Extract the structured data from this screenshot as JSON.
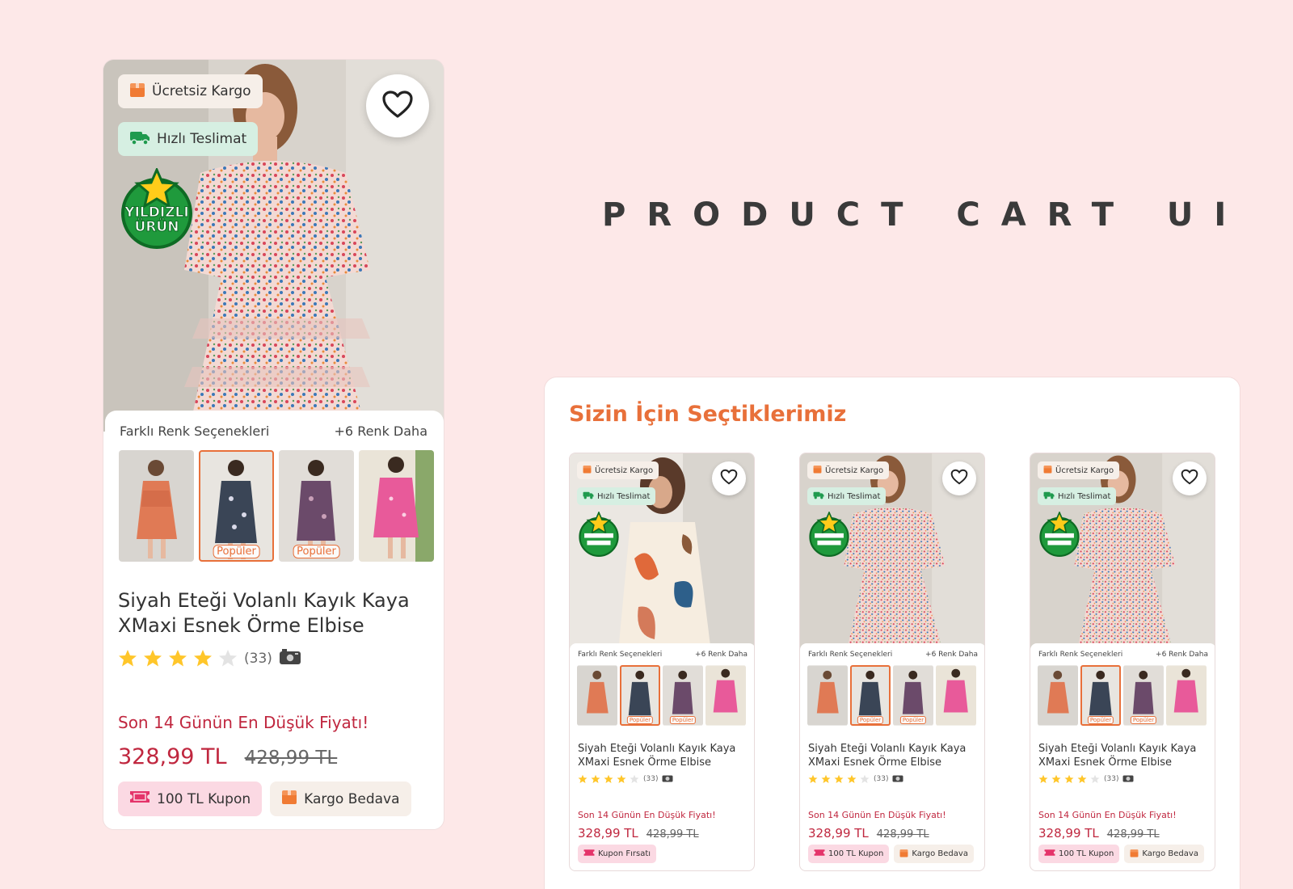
{
  "heading": "PRODUCT CART UI",
  "colors": {
    "accent": "#e8703a",
    "price": "#c0273f",
    "background": "#fde8e8"
  },
  "featured": {
    "badges": {
      "cargo": "Ücretsiz Kargo",
      "fast": "Hızlı Teslimat"
    },
    "star_badge_top": "YILDIZLI",
    "star_badge_bottom": "ÜRÜN",
    "colors_label": "Farklı Renk Seçenekleri",
    "more_colors": "+6 Renk Daha",
    "popular_tag": "Popüler",
    "title": "Siyah Eteği Volanlı Kayık Kaya XMaxi Esnek Örme Elbise",
    "rating": 4,
    "review_count": "(33)",
    "lowest_price_note": "Son 14 Günün En Düşük Fiyatı!",
    "price": "328,99 TL",
    "old_price": "428,99 TL",
    "tags": {
      "coupon": "100 TL Kupon",
      "cargo": "Kargo Bedava"
    }
  },
  "recommendations": {
    "title": "Sizin İçin Seçtiklerimiz",
    "cards": [
      {
        "badges": {
          "cargo": "Ücretsiz Kargo",
          "fast": "Hızlı Teslimat"
        },
        "colors_label": "Farklı Renk Seçenekleri",
        "more_colors": "+6 Renk Daha",
        "popular_tag": "Popüler",
        "title": "Siyah Eteği Volanlı Kayık Kaya XMaxi Esnek Örme Elbise",
        "review_count": "(33)",
        "lowest_price_note": "Son 14 Günün En Düşük Fiyatı!",
        "price": "328,99 TL",
        "old_price": "428,99 TL",
        "tags": {
          "coupon": "Kupon Fırsatı"
        }
      },
      {
        "badges": {
          "cargo": "Ücretsiz Kargo",
          "fast": "Hızlı Teslimat"
        },
        "colors_label": "Farklı Renk Seçenekleri",
        "more_colors": "+6 Renk Daha",
        "popular_tag": "Popüler",
        "title": "Siyah Eteği Volanlı Kayık Kaya XMaxi Esnek Örme Elbise",
        "review_count": "(33)",
        "lowest_price_note": "Son 14 Günün En Düşük Fiyatı!",
        "price": "328,99 TL",
        "old_price": "428,99 TL",
        "tags": {
          "coupon": "100 TL Kupon",
          "cargo": "Kargo Bedava"
        }
      },
      {
        "badges": {
          "cargo": "Ücretsiz Kargo",
          "fast": "Hızlı Teslimat"
        },
        "colors_label": "Farklı Renk Seçenekleri",
        "more_colors": "+6 Renk Daha",
        "popular_tag": "Popüler",
        "title": "Siyah Eteği Volanlı Kayık Kaya XMaxi Esnek Örme Elbise",
        "review_count": "(33)",
        "lowest_price_note": "Son 14 Günün En Düşük Fiyatı!",
        "price": "328,99 TL",
        "old_price": "428,99 TL",
        "tags": {
          "coupon": "100 TL Kupon",
          "cargo": "Kargo Bedava"
        }
      }
    ]
  }
}
